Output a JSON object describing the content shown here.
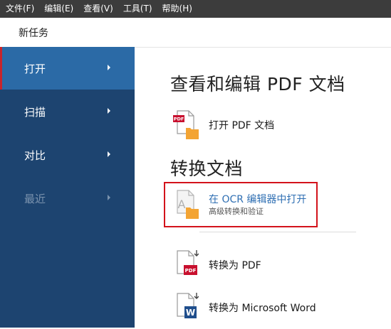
{
  "menu": [
    {
      "label": "文件(F)"
    },
    {
      "label": "编辑(E)"
    },
    {
      "label": "查看(V)"
    },
    {
      "label": "工具(T)"
    },
    {
      "label": "帮助(H)"
    }
  ],
  "task_title": "新任务",
  "sidebar": {
    "items": [
      {
        "label": "打开",
        "state": "active"
      },
      {
        "label": "扫描",
        "state": "normal"
      },
      {
        "label": "对比",
        "state": "normal"
      },
      {
        "label": "最近",
        "state": "disabled"
      }
    ]
  },
  "main": {
    "section_view": {
      "heading": "查看和编辑 PDF 文档",
      "items": [
        {
          "label": "打开 PDF 文档",
          "icon": "pdf-folder-icon"
        }
      ]
    },
    "section_convert": {
      "heading": "转换文档",
      "items": [
        {
          "label": "在 OCR 编辑器中打开",
          "sublabel": "高级转换和验证",
          "icon": "ocr-folder-icon",
          "highlighted": true
        },
        {
          "label": "转换为 PDF",
          "icon": "convert-pdf-icon"
        },
        {
          "label": "转换为 Microsoft Word",
          "icon": "convert-word-icon"
        }
      ]
    }
  },
  "colors": {
    "menubar_bg": "#3c3c3c",
    "sidebar_bg": "#1d4470",
    "sidebar_active_bg": "#2b6aa6",
    "highlight_border": "#d3121b",
    "link_blue": "#2f6fb3",
    "folder_orange": "#f3a433",
    "pdf_red": "#c8102e",
    "word_blue": "#1f4e8c"
  }
}
